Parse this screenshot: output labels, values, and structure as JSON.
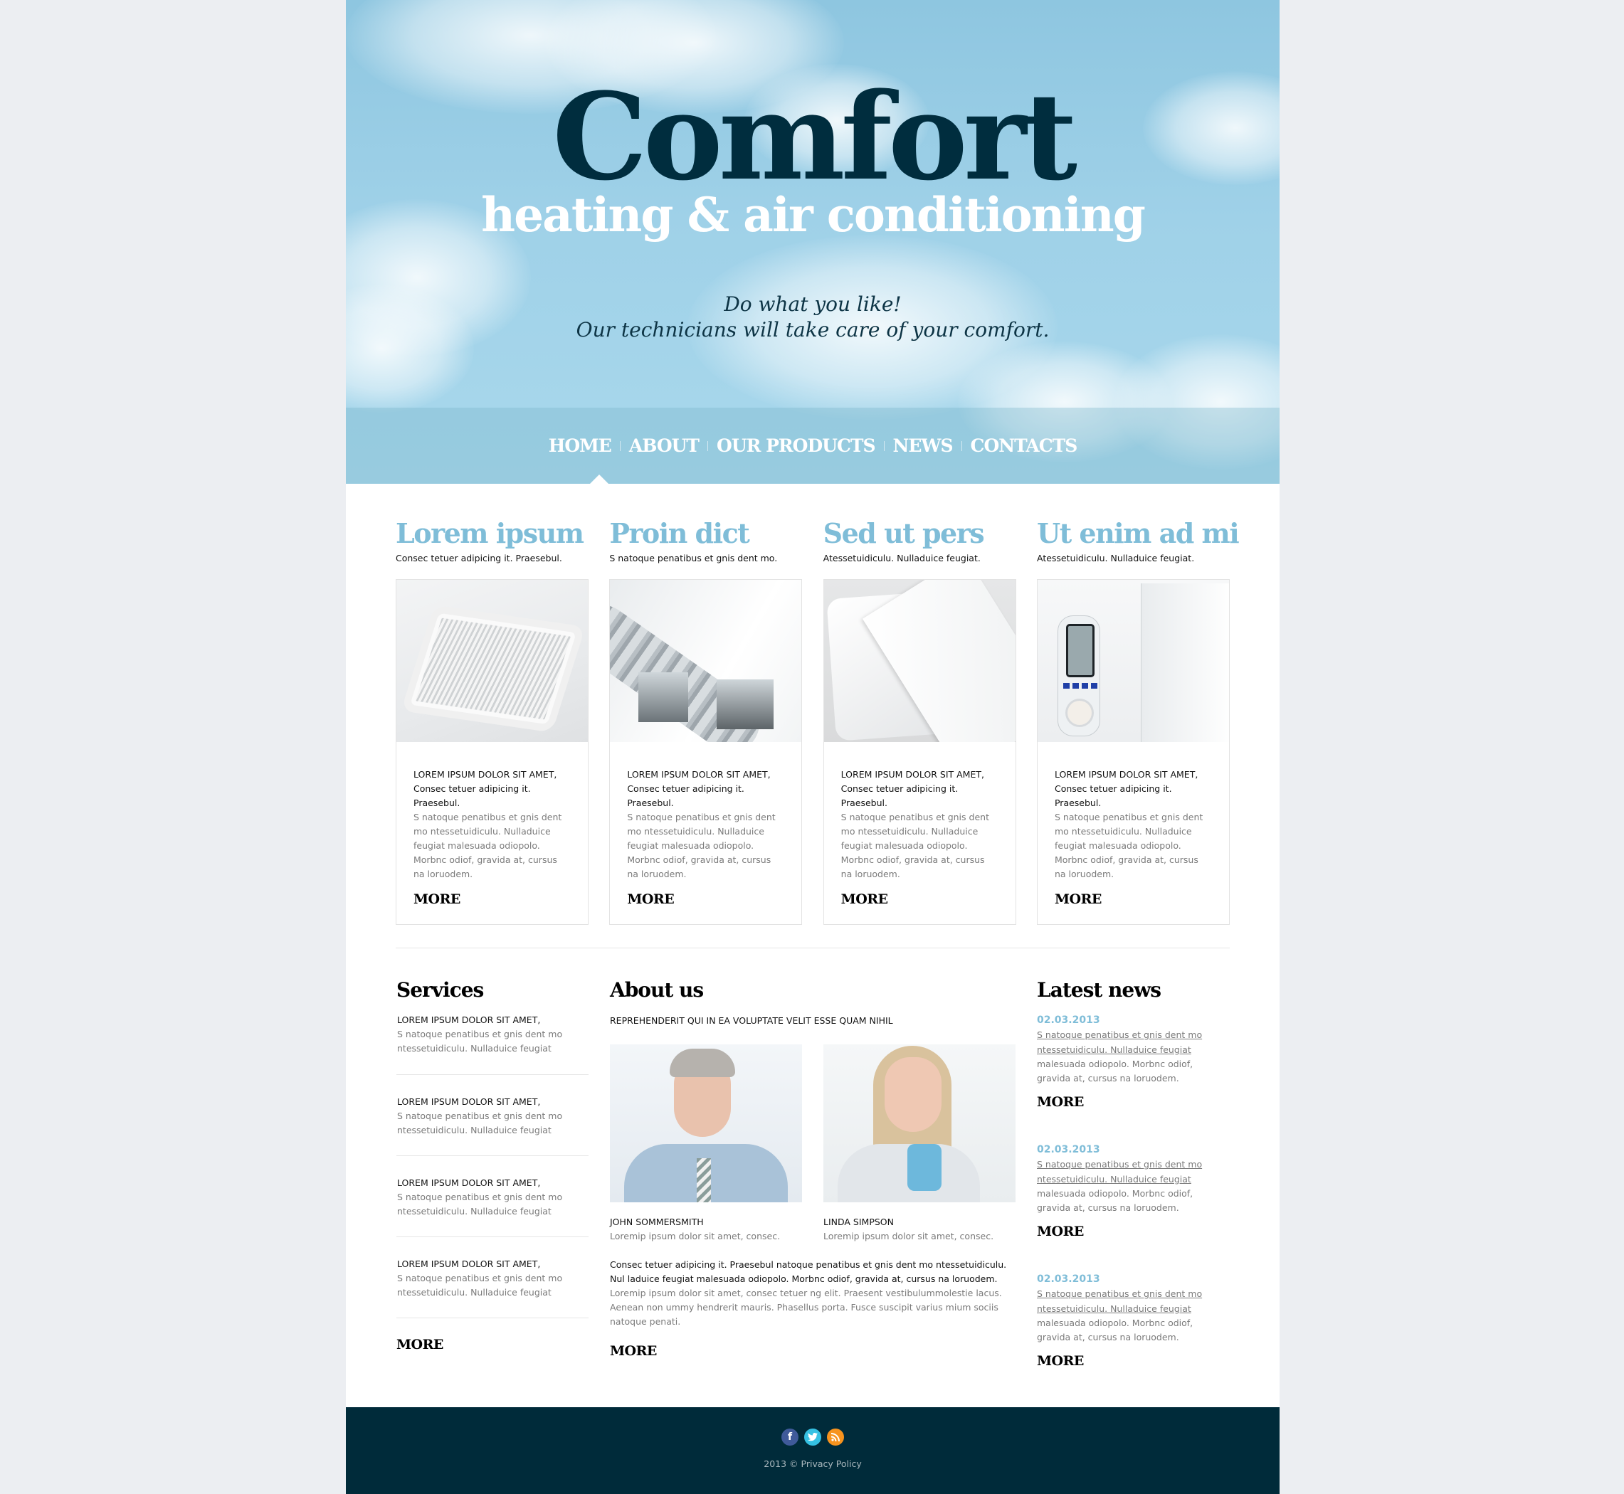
{
  "header": {
    "brand": "Comfort",
    "subtitle": "heating & air conditioning",
    "tagline_line1": "Do what you like!",
    "tagline_line2": "Our technicians will take care of your comfort."
  },
  "nav": {
    "items": [
      {
        "label": "HOME",
        "active": true
      },
      {
        "label": "ABOUT",
        "active": false
      },
      {
        "label": "OUR PRODUCTS",
        "active": false
      },
      {
        "label": "NEWS",
        "active": false
      },
      {
        "label": "CONTACTS",
        "active": false
      }
    ]
  },
  "features": [
    {
      "title": "Lorem ipsum",
      "subtitle": "Consec tetuer adipicing it. Praesebul.",
      "image": "ceiling-cassette-ac",
      "caps": "LOREM IPSUM DOLOR SIT AMET,",
      "lead": "Consec tetuer adipicing it. Praesebul.",
      "body": "S natoque penatibus et gnis dent mo ntessetuidiculu. Nulladuice feugiat malesuada odiopolo. Morbnc odiof, gravida at, cursus na loruodem.",
      "more": "MORE"
    },
    {
      "title": "Proin dict",
      "subtitle": "S natoque penatibus et gnis dent mo.",
      "image": "ventilation-ducts",
      "caps": "LOREM IPSUM DOLOR SIT AMET,",
      "lead": "Consec tetuer adipicing it. Praesebul.",
      "body": "S natoque penatibus et gnis dent mo ntessetuidiculu. Nulladuice feugiat malesuada odiopolo. Morbnc odiof, gravida at, cursus na loruodem.",
      "more": "MORE"
    },
    {
      "title": "Sed ut pers",
      "subtitle": "Atessetuidiculu. Nulladuice feugiat.",
      "image": "split-ac-unit",
      "caps": "LOREM IPSUM DOLOR SIT AMET,",
      "lead": "Consec tetuer adipicing it. Praesebul.",
      "body": "S natoque penatibus et gnis dent mo ntessetuidiculu. Nulladuice feugiat malesuada odiopolo. Morbnc odiof, gravida at, cursus na loruodem.",
      "more": "MORE"
    },
    {
      "title": "Ut enim ad mi",
      "subtitle": "Atessetuidiculu. Nulladuice feugiat.",
      "image": "energy-meter-plug",
      "caps": "LOREM IPSUM DOLOR SIT AMET,",
      "lead": "Consec tetuer adipicing it. Praesebul.",
      "body": "S natoque penatibus et gnis dent mo ntessetuidiculu. Nulladuice feugiat malesuada odiopolo. Morbnc odiof, gravida at, cursus na loruodem.",
      "more": "MORE"
    }
  ],
  "services": {
    "title": "Services",
    "items": [
      {
        "caps": "LOREM IPSUM DOLOR SIT AMET,",
        "line1": "S natoque penatibus et gnis dent mo",
        "line2": "ntessetuidiculu. Nulladuice feugiat"
      },
      {
        "caps": "LOREM IPSUM DOLOR SIT AMET,",
        "line1": "S natoque penatibus et gnis dent mo",
        "line2": "ntessetuidiculu. Nulladuice feugiat"
      },
      {
        "caps": "LOREM IPSUM DOLOR SIT AMET,",
        "line1": "S natoque penatibus et gnis dent mo",
        "line2": "ntessetuidiculu. Nulladuice feugiat"
      },
      {
        "caps": "LOREM IPSUM DOLOR SIT AMET,",
        "line1": "S natoque penatibus et gnis dent mo",
        "line2": "ntessetuidiculu. Nulladuice feugiat"
      }
    ],
    "more": "MORE"
  },
  "about": {
    "title": "About us",
    "caps_line": "REPREHENDERIT QUI IN EA VOLUPTATE VELIT ESSE QUAM NIHIL",
    "people": [
      {
        "name": "JOHN SOMMERSMITH",
        "role": "Loremip ipsum dolor sit amet, consec."
      },
      {
        "name": "LINDA SIMPSON",
        "role": "Loremip ipsum dolor sit amet, consec."
      }
    ],
    "para_dark": "Consec tetuer adipicing it. Praesebul natoque penatibus et gnis dent mo ntessetuidiculu. Nul laduice feugiat  malesuada odiopolo. Morbnc odiof,  gravida at, cursus na loruodem.",
    "para_muted": "Loremip ipsum dolor sit amet, consec tetuer ng elit. Praesent vestibulummolestie lacus. Aenean non ummy hendrerit mauris. Phasellus porta. Fusce suscipit varius mium sociis natoque penati.",
    "more": "MORE"
  },
  "news": {
    "title": "Latest news",
    "items": [
      {
        "date": "02.03.2013",
        "link": "S natoque penatibus et gnis dent mo ntessetuidiculu. Nulladuice feugiat",
        "text": "malesuada odiopolo. Morbnc odiof, gravida at, cursus na loruodem.",
        "more": "MORE"
      },
      {
        "date": "02.03.2013",
        "link": "S natoque penatibus et gnis dent mo ntessetuidiculu. Nulladuice feugiat",
        "text": "malesuada odiopolo. Morbnc odiof, gravida at, cursus na loruodem.",
        "more": "MORE"
      },
      {
        "date": "02.03.2013",
        "link": "S natoque penatibus et gnis dent mo ntessetuidiculu. Nulladuice feugiat",
        "text": "malesuada odiopolo. Morbnc odiof, gravida at, cursus na loruodem.",
        "more": "MORE"
      }
    ]
  },
  "footer": {
    "social": [
      {
        "name": "facebook",
        "glyph": "f",
        "color": "#3f5a9a"
      },
      {
        "name": "twitter",
        "glyph": "t",
        "color": "#35c1e3"
      },
      {
        "name": "rss",
        "glyph": "◉",
        "color": "#f7931e"
      }
    ],
    "year": "2013 ©",
    "privacy": "Privacy Policy"
  },
  "colors": {
    "accent": "#7fbdd8",
    "brand_dark": "#002d3e",
    "footer_bg": "#002b3a",
    "page_bg": "#eceef2"
  }
}
